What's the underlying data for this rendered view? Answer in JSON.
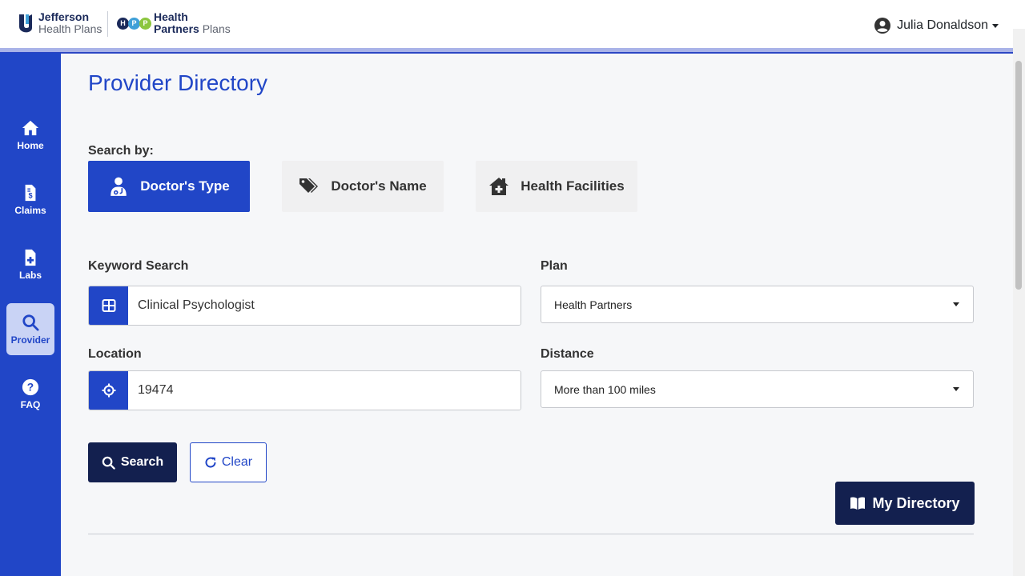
{
  "header": {
    "logo1": {
      "line1": "Jefferson",
      "line2": "Health Plans"
    },
    "logo2": {
      "circles": [
        "H",
        "P",
        "P"
      ],
      "line1": "Health",
      "line2a": "Partners",
      "line2b": "Plans"
    },
    "user_name": "Julia Donaldson"
  },
  "sidebar": {
    "items": [
      {
        "label": "Home",
        "icon": "home-icon"
      },
      {
        "label": "Claims",
        "icon": "claims-document-icon"
      },
      {
        "label": "Labs",
        "icon": "labs-document-icon"
      },
      {
        "label": "Provider",
        "icon": "search-icon",
        "active": true
      },
      {
        "label": "FAQ",
        "icon": "question-circle-icon"
      }
    ]
  },
  "main": {
    "title": "Provider Directory",
    "search_by_label": "Search by:",
    "search_types": [
      {
        "label": "Doctor's Type",
        "icon": "doctor-icon",
        "active": true
      },
      {
        "label": "Doctor's Name",
        "icon": "tags-icon"
      },
      {
        "label": "Health Facilities",
        "icon": "house-medical-icon"
      }
    ],
    "keyword": {
      "label": "Keyword Search",
      "value": "Clinical Psychologist"
    },
    "plan": {
      "label": "Plan",
      "value": "Health Partners"
    },
    "location": {
      "label": "Location",
      "value": "19474"
    },
    "distance": {
      "label": "Distance",
      "value": "More than 100 miles"
    },
    "search_button": "Search",
    "clear_button": "Clear",
    "my_directory_button": "My Directory"
  },
  "colors": {
    "primary": "#2146c7",
    "dark": "#13204f",
    "background": "#f6f7f9"
  }
}
